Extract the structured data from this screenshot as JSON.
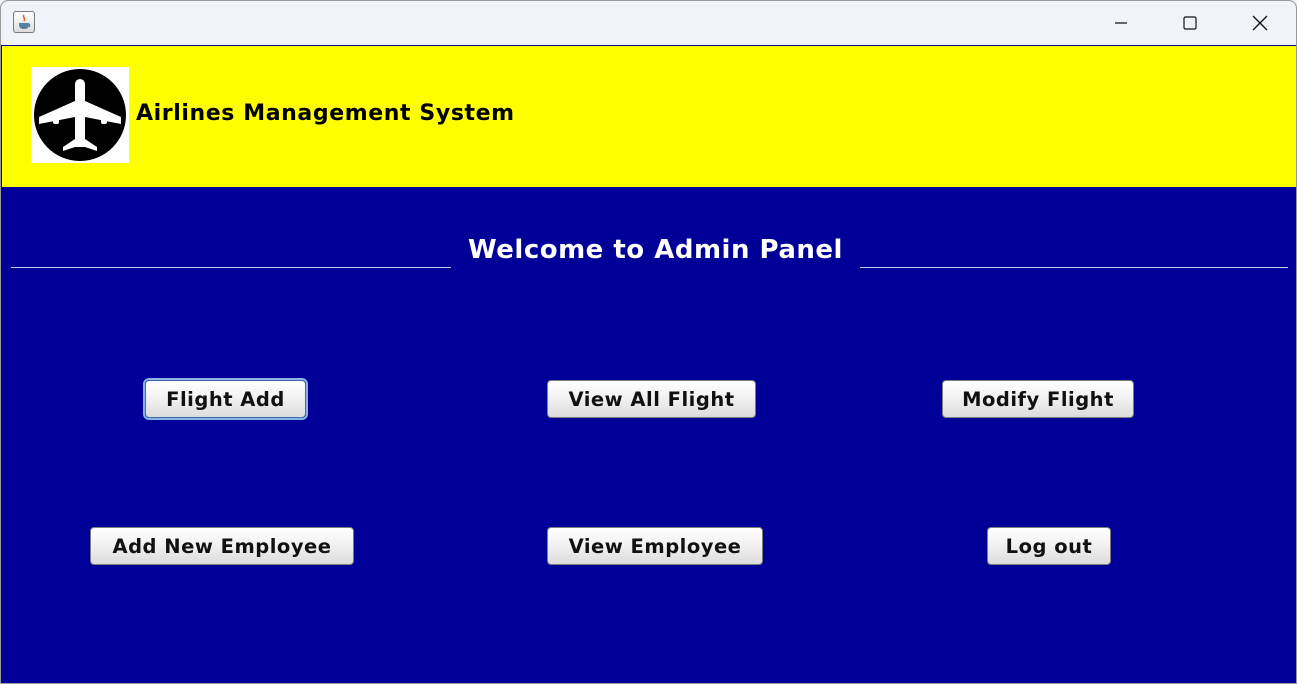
{
  "window": {
    "icon": "java-app-icon",
    "controls": [
      "minimize-icon",
      "maximize-icon",
      "close-icon"
    ]
  },
  "header": {
    "logo_icon": "airplane-logo-icon",
    "title": "Airlines Management System",
    "background": "#ffff00"
  },
  "panel": {
    "heading": "Welcome to Admin Panel",
    "background": "#000099"
  },
  "buttons": {
    "flight_add": "Flight Add",
    "view_all_flight": "View All Flight",
    "modify_flight": "Modify Flight",
    "add_new_employee": "Add New Employee",
    "view_employee": "View Employee",
    "log_out": "Log out"
  }
}
